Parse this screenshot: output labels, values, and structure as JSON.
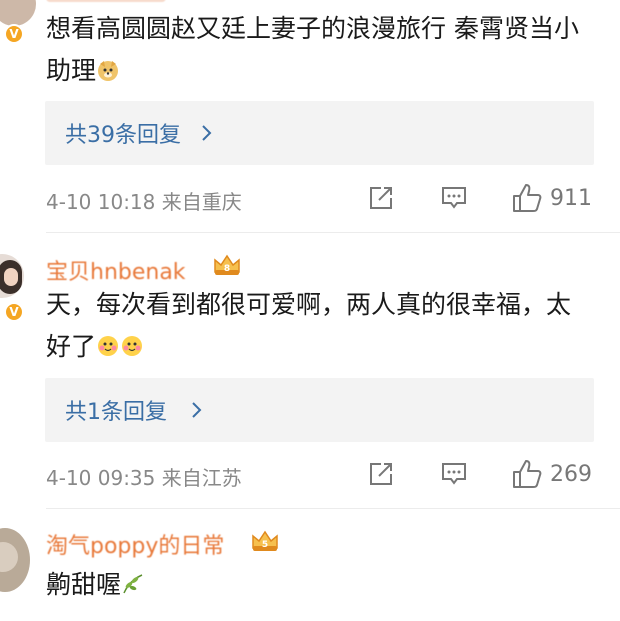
{
  "comments": [
    {
      "text": "想看高圆圆赵又廷上妻子的浪漫旅行 秦霄贤当小助理",
      "replies_label": "共39条回复",
      "meta": "4-10 10:18 来自重庆",
      "likes": "911",
      "icons": [
        "verified-badge-icon",
        "doge-emoji",
        "share-icon",
        "comment-icon",
        "like-icon",
        "chevron-right-icon"
      ]
    },
    {
      "username": "宝贝hnbenak",
      "text": "天，每次看到都很可爱啊，两人真的很幸福，太好了",
      "replies_label": "共1条回复",
      "meta": "4-10 09:35 来自江苏",
      "likes": "269",
      "icons": [
        "verified-badge-icon",
        "crown-badge-icon",
        "cute-emoji",
        "share-icon",
        "comment-icon",
        "like-icon"
      ]
    },
    {
      "username": "淘气poppy的日常",
      "text": "齁甜喔",
      "icons": [
        "avatar-image",
        "crown-badge-icon",
        "leaf-emoji"
      ]
    }
  ],
  "colors": {
    "username": "#e8793a",
    "link": "#3a6ea5",
    "meta": "#888888",
    "badge": "#f5a623"
  }
}
